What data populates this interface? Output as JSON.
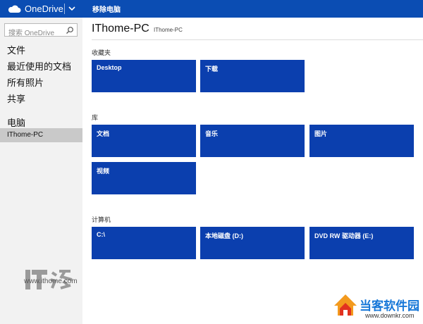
{
  "topbar": {
    "brand": "OneDrive",
    "command": "移除电脑"
  },
  "sidebar": {
    "search_placeholder": "搜索 OneDrive",
    "items": [
      "文件",
      "最近使用的文档",
      "所有照片",
      "共享"
    ],
    "section": "电脑",
    "active_item": "IThome-PC"
  },
  "main": {
    "title": "IThome-PC",
    "subtitle": "IThome-PC",
    "sections": [
      {
        "label": "收藏夹",
        "tiles": [
          "Desktop",
          "下载"
        ]
      },
      {
        "label": "库",
        "tiles": [
          "文档",
          "音乐",
          "图片",
          "视频"
        ]
      },
      {
        "label": "计算机",
        "tiles": [
          "C:\\",
          "本地磁盘 (D:)",
          "DVD RW 驱动器 (E:)"
        ]
      }
    ]
  },
  "watermarks": {
    "ithome_url": "www.ithome.com",
    "downkr_name": "当客软件园",
    "downkr_url": "www.downkr.com"
  },
  "colors": {
    "topbar": "#0b4db3",
    "tile": "#0b3fae",
    "sidebar": "#f2f2f2",
    "active": "#c9c9c9"
  }
}
